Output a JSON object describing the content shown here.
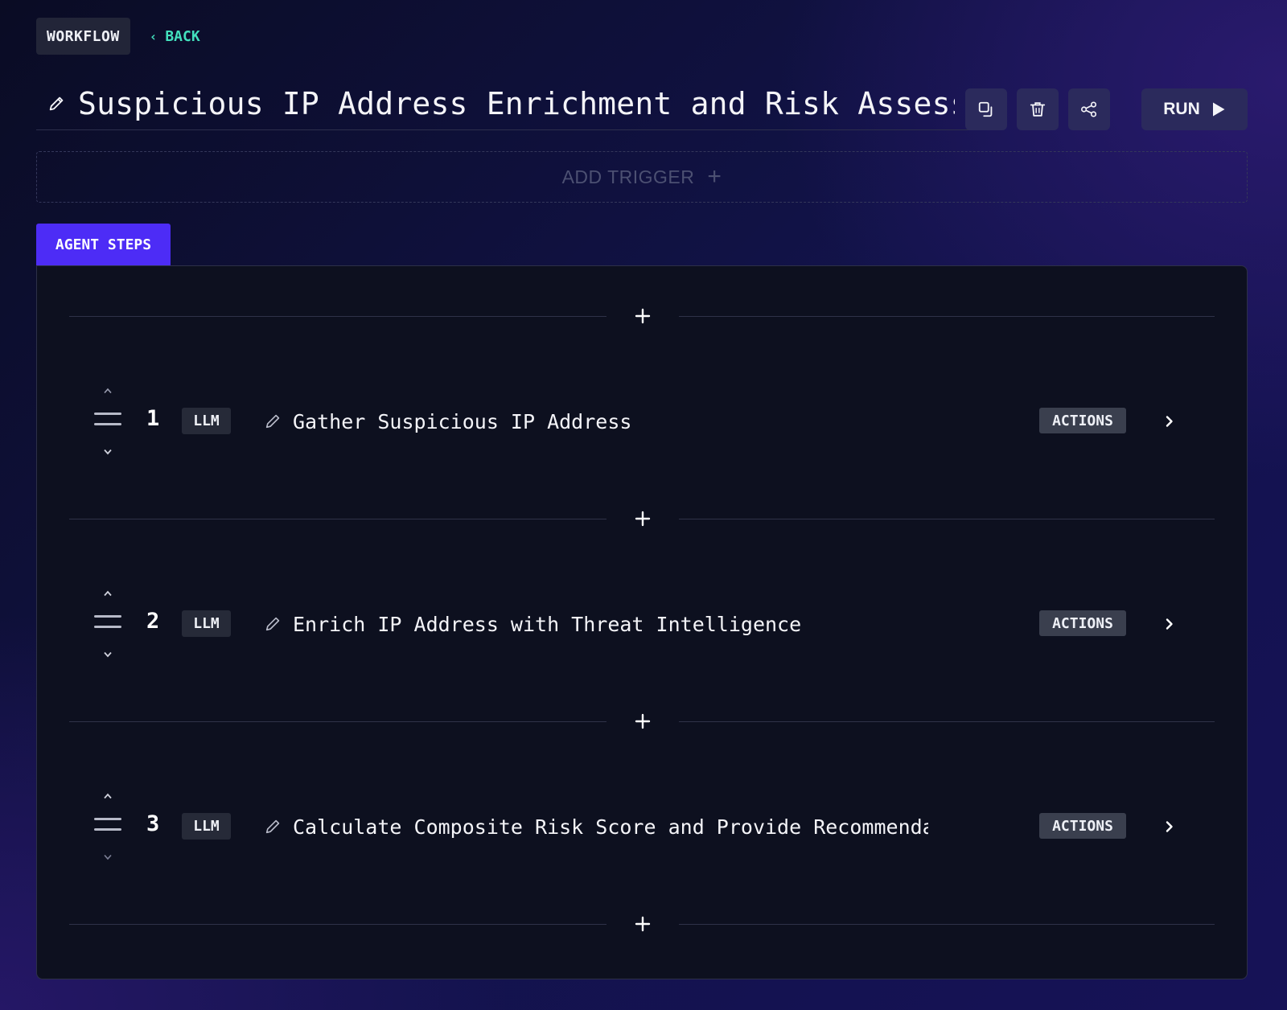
{
  "header": {
    "workflow_label": "WORKFLOW",
    "back_label": "BACK",
    "title": "Suspicious IP Address Enrichment and Risk Assessment",
    "run_label": "RUN"
  },
  "trigger": {
    "add_label": "ADD TRIGGER"
  },
  "tabs": [
    {
      "label": "AGENT STEPS",
      "active": true
    }
  ],
  "steps": [
    {
      "number": "1",
      "type": "LLM",
      "name": "Gather Suspicious IP Address",
      "actions_label": "ACTIONS"
    },
    {
      "number": "2",
      "type": "LLM",
      "name": "Enrich IP Address with Threat Intelligence",
      "actions_label": "ACTIONS"
    },
    {
      "number": "3",
      "type": "LLM",
      "name": "Calculate Composite Risk Score and Provide Recommendations",
      "actions_label": "ACTIONS"
    }
  ],
  "icons": {
    "title_edit": "pencil-icon",
    "duplicate": "copy-icon",
    "delete": "trash-icon",
    "share": "share-icon",
    "run": "play-icon",
    "add_step": "plus-icon",
    "reorder": "drag-handle-icon",
    "expand": "chevron-right-icon"
  },
  "colors": {
    "accent_tab": "#4d2cf6",
    "back_link": "#43e0bd",
    "panel_bg": "#0d101f",
    "button_bg": "#2b2a5c",
    "badge_bg": "#262a38"
  }
}
